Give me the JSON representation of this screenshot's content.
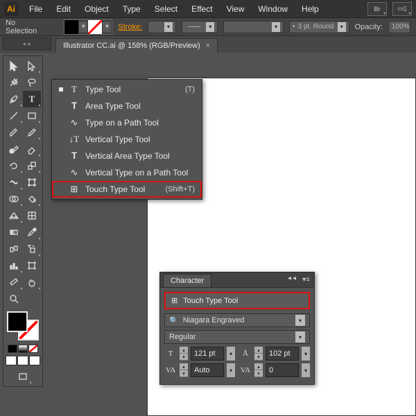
{
  "menubar": {
    "items": [
      "File",
      "Edit",
      "Object",
      "Type",
      "Select",
      "Effect",
      "View",
      "Window",
      "Help"
    ],
    "right": [
      "Br"
    ]
  },
  "controlbar": {
    "selection": "No Selection",
    "stroke_label": "Stroke:",
    "brush_preset": "3 pt. Round",
    "opacity_label": "Opacity:",
    "opacity_value": "100%"
  },
  "document_tab": {
    "title": "Illustrator CC.ai @ 158% (RGB/Preview)"
  },
  "flyout": {
    "items": [
      {
        "icon": "T",
        "label": "Type Tool",
        "shortcut": "(T)",
        "current": true
      },
      {
        "icon": "𝐓",
        "label": "Area Type Tool",
        "shortcut": ""
      },
      {
        "icon": "✎",
        "label": "Type on a Path Tool",
        "shortcut": ""
      },
      {
        "icon": "↓T",
        "label": "Vertical Type Tool",
        "shortcut": ""
      },
      {
        "icon": "𝐓",
        "label": "Vertical Area Type Tool",
        "shortcut": ""
      },
      {
        "icon": "✎",
        "label": "Vertical Type on a Path Tool",
        "shortcut": ""
      },
      {
        "icon": "⊞",
        "label": "Touch Type Tool",
        "shortcut": "(Shift+T)",
        "highlight": true
      }
    ]
  },
  "char_panel": {
    "title": "Character",
    "touch_label": "Touch Type Tool",
    "font": "Niagara Engraved",
    "style": "Regular",
    "size": "121 pt",
    "leading": "102 pt",
    "kerning": "Auto",
    "tracking": "0"
  }
}
